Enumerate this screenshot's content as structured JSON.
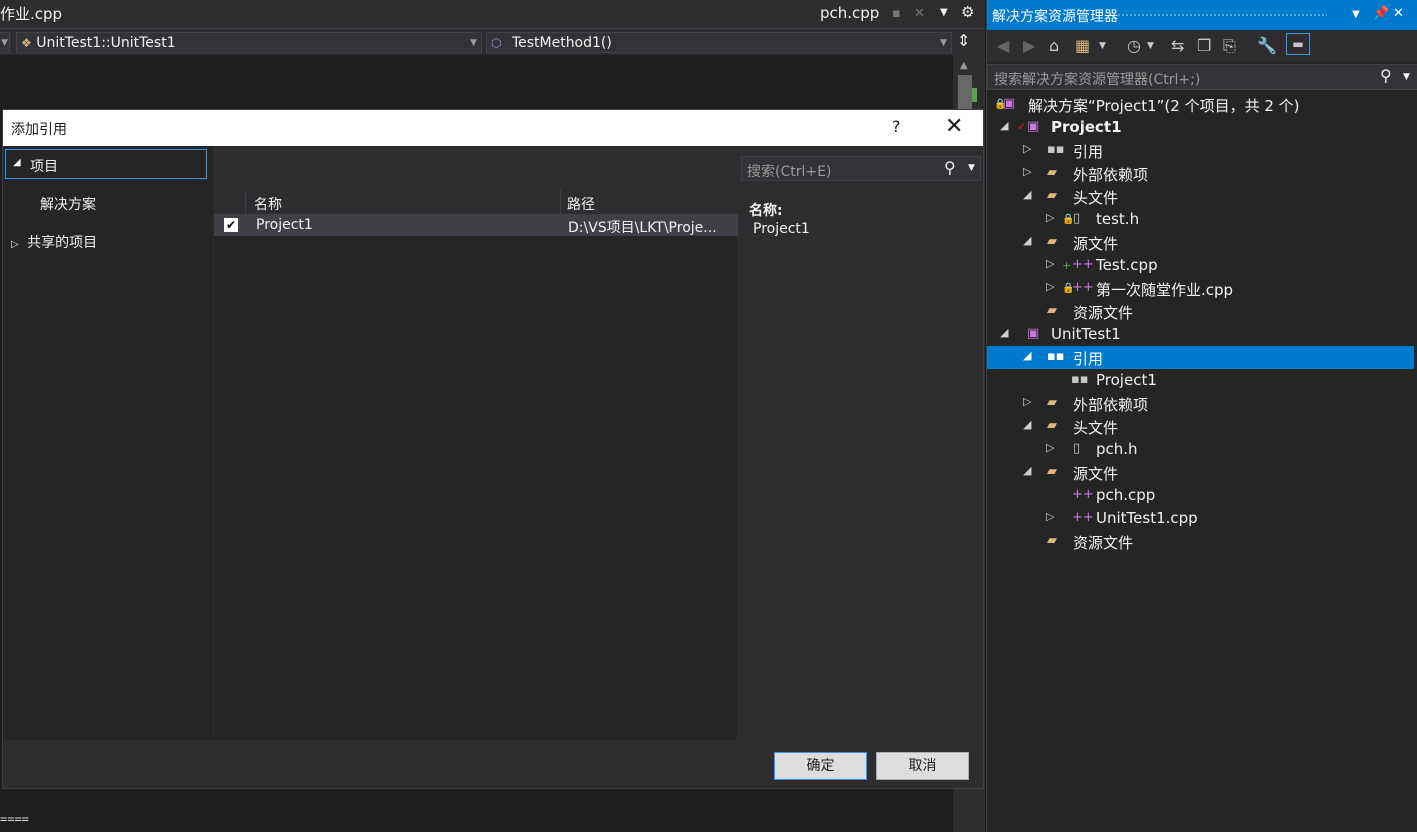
{
  "editor": {
    "tab_left": "作业.cpp",
    "tab_right": "pch.cpp",
    "nav_scope": "UnitTest1::UnitTest1",
    "nav_member": "TestMethod1()",
    "bottom_text": "===="
  },
  "dialog": {
    "title": "添加引用",
    "help": "?",
    "left_nav": {
      "project": "项目",
      "solution": "解决方案",
      "shared": "共享的项目"
    },
    "search_placeholder": "搜索(Ctrl+E)",
    "columns": {
      "name": "名称",
      "path": "路径"
    },
    "rows": [
      {
        "checked": true,
        "name": "Project1",
        "path": "D:\\VS项目\\LKT\\Proje..."
      }
    ],
    "details": {
      "label": "名称:",
      "value": "Project1"
    },
    "ok_label": "确定",
    "cancel_label": "取消"
  },
  "solution_explorer": {
    "title": "解决方案资源管理器",
    "search_placeholder": "搜索解决方案资源管理器(Ctrl+;)",
    "tree": [
      {
        "label": "解决方案“Project1”(2 个项目，共 2 个)"
      },
      {
        "label": "Project1"
      },
      {
        "label": "引用"
      },
      {
        "label": "外部依赖项"
      },
      {
        "label": "头文件"
      },
      {
        "label": "test.h"
      },
      {
        "label": "源文件"
      },
      {
        "label": "Test.cpp"
      },
      {
        "label": "第一次随堂作业.cpp"
      },
      {
        "label": "资源文件"
      },
      {
        "label": "UnitTest1"
      },
      {
        "label": "引用"
      },
      {
        "label": "Project1"
      },
      {
        "label": "外部依赖项"
      },
      {
        "label": "头文件"
      },
      {
        "label": "pch.h"
      },
      {
        "label": "源文件"
      },
      {
        "label": "pch.cpp"
      },
      {
        "label": "UnitTest1.cpp"
      },
      {
        "label": "资源文件"
      }
    ]
  },
  "colors": {
    "accent": "#007acc",
    "selection": "#3399ff",
    "folder": "#dcb67a",
    "cpp": "#c678dd"
  }
}
